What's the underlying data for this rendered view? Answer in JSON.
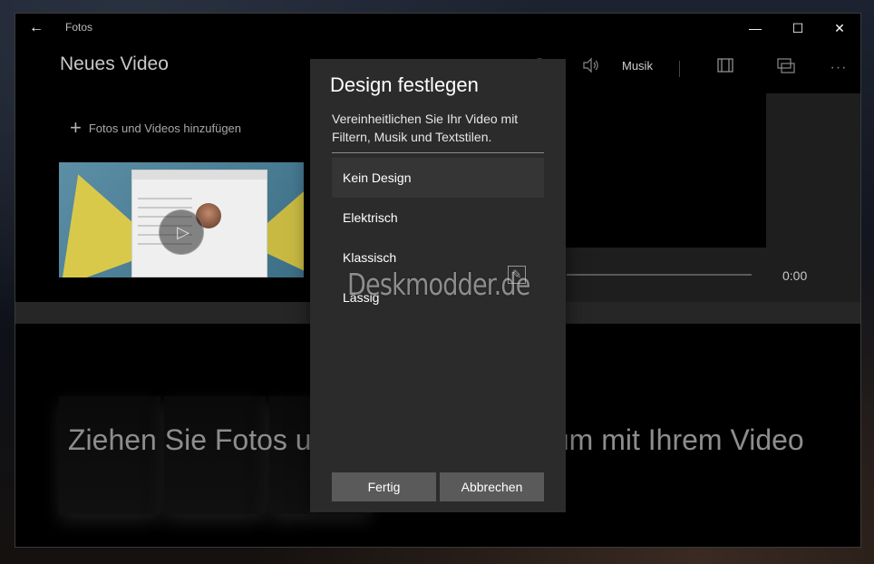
{
  "window": {
    "app_title": "Fotos",
    "back_icon": "arrow-left-icon",
    "controls": {
      "minimize": "—",
      "maximize": "☐",
      "close": "✕"
    }
  },
  "header": {
    "project_title": "Neues Video",
    "music_label": "Musik",
    "icons": [
      "undo-icon",
      "redo-icon",
      "theme-palette-icon",
      "speaker-icon",
      "aspect-ratio-icon",
      "export-icon",
      "more-icon"
    ]
  },
  "library": {
    "add_label": "Fotos und Videos hinzufügen"
  },
  "preview": {
    "time": "0:00"
  },
  "storyboard": {
    "hint": "Ziehen Sie Fotos und Videos hierher, um mit Ihrem Video"
  },
  "dialog": {
    "title": "Design festlegen",
    "description": "Vereinheitlichen Sie Ihr Video mit Filtern, Musik und Textstilen.",
    "themes": [
      {
        "label": "Kein Design",
        "selected": true
      },
      {
        "label": "Elektrisch",
        "selected": false
      },
      {
        "label": "Klassisch",
        "selected": false
      },
      {
        "label": "Lässig",
        "selected": false
      }
    ],
    "done_label": "Fertig",
    "cancel_label": "Abbrechen"
  },
  "watermark": {
    "text": "Deskmodder.de"
  },
  "colors": {
    "dialog_bg": "#2b2b2b",
    "button_bg": "#5a5a5a",
    "selected_item_bg": "#353535"
  }
}
